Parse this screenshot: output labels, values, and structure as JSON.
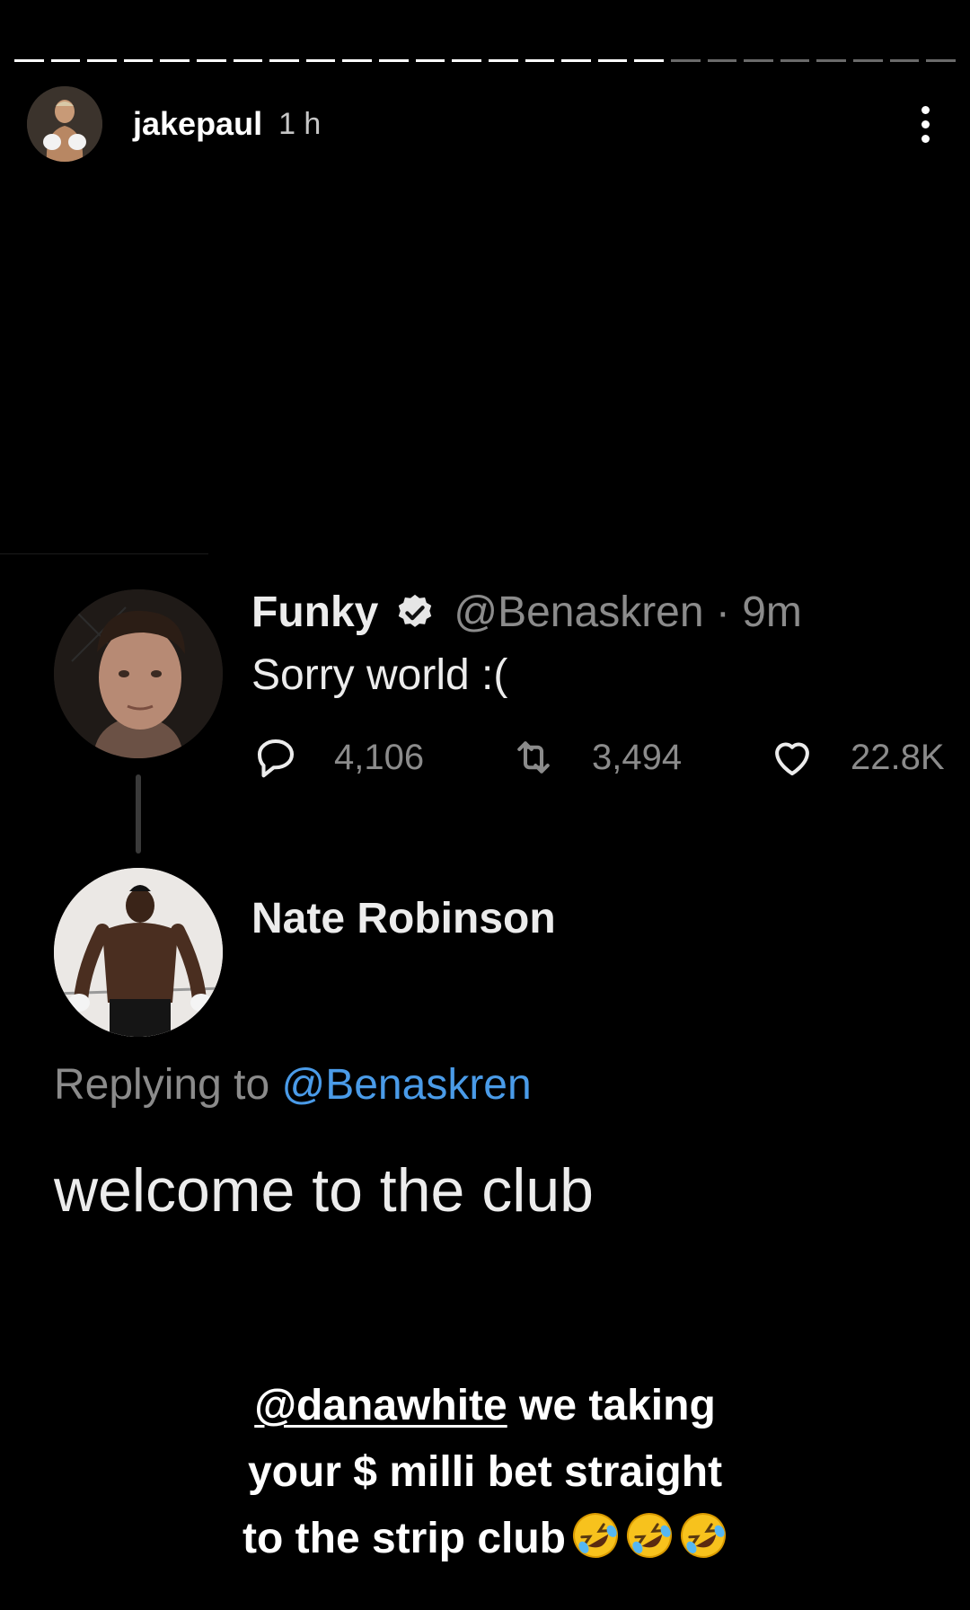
{
  "story": {
    "username": "jakepaul",
    "time": "1 h",
    "progress_segments": 26,
    "progress_filled": 18
  },
  "tweet": {
    "name": "Funky",
    "handle": "@Benaskren · 9m",
    "text": "Sorry world :(",
    "replies": "4,106",
    "retweets": "3,494",
    "likes": "22.8K"
  },
  "reply": {
    "name": "Nate Robinson",
    "replying_prefix": "Replying to",
    "replying_handle": "@Benaskren",
    "text": "welcome to the club"
  },
  "caption": {
    "mention": "@danawhite",
    "line1_rest": " we taking",
    "line2": "your $ milli bet straight",
    "line3": "to the strip club",
    "emoji_count": 3
  },
  "colors": {
    "background": "#000000",
    "link_blue": "#4a9be8",
    "muted_gray": "#8b8b8b"
  }
}
